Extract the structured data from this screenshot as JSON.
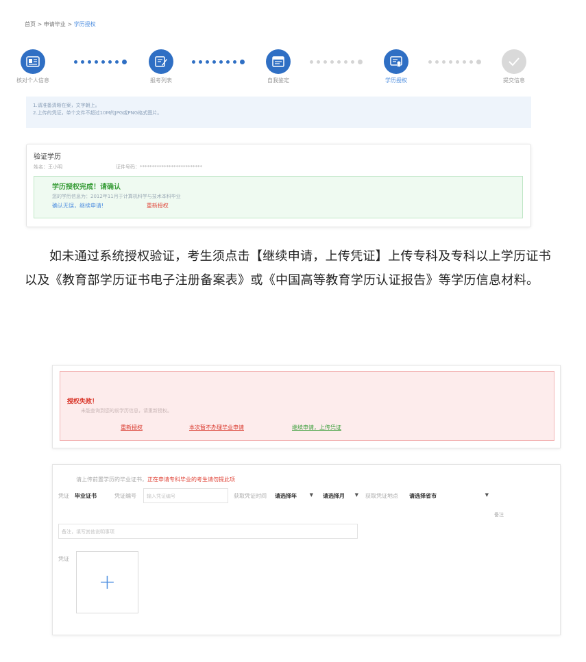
{
  "breadcrumb": {
    "home": "首页",
    "sep": " > ",
    "apply": "申请毕业",
    "current": "学历授权"
  },
  "steps": [
    {
      "label": "核对个人信息",
      "state": "active",
      "icon": "id-card-icon"
    },
    {
      "label": "报考列表",
      "state": "active",
      "icon": "list-edit-icon"
    },
    {
      "label": "自我鉴定",
      "state": "active",
      "icon": "document-icon"
    },
    {
      "label": "学历授权",
      "state": "active",
      "icon": "certificate-icon"
    },
    {
      "label": "提交信息",
      "state": "done",
      "icon": "check-icon"
    }
  ],
  "tips": [
    "1.请准备清晰在案，文字朝上。",
    "2.上传的凭证，单个文件不超过10M的JPG或PNG格式图片。"
  ],
  "verify": {
    "title": "验证学历",
    "name_label": "姓名：",
    "name_value": "王小明",
    "id_label": "证件号码：",
    "id_value": "**************************",
    "success_title": "学历授权完成！请确认",
    "success_desc": "您的学历信息为：2012年11月于计算机科学与技术本科毕业",
    "confirm_link": "确认无误，继续申请!",
    "reauth_link": "重新授权"
  },
  "paragraph": "如未通过系统授权验证，考生须点击【继续申请，上传凭证】上传专科及专科以上学历证书以及《教育部学历证书电子注册备案表》或《中国高等教育学历认证报告》等学历信息材料。",
  "fail": {
    "title": "授权失败！",
    "desc": "未能查询到您的前学历信息，请重新授权。",
    "reauth": "重新授权",
    "not_apply": "本次暂不办理毕业申请",
    "continue": "继续申请，上传凭证"
  },
  "upload": {
    "hint": "请上传前置学历的毕业证书，",
    "hint_warn": "正在申请专科毕业的考生请勿提此项",
    "cert_type_label": "凭证",
    "cert_type_value": "毕业证书",
    "cert_no_label": "凭证编号",
    "cert_no_placeholder": "输入凭证编号",
    "time_label": "获取凭证时间",
    "year_select": "请选择年",
    "month_select": "请选择月",
    "place_label": "获取凭证地点",
    "place_select": "请选择省市",
    "remark_label": "备注",
    "remark_placeholder": "备注，填写其他说明事项",
    "image_label": "凭证",
    "add_symbol": "+"
  },
  "colors": {
    "primary": "#2f6fc4",
    "success": "#3a9e3a",
    "danger": "#d9372b"
  }
}
